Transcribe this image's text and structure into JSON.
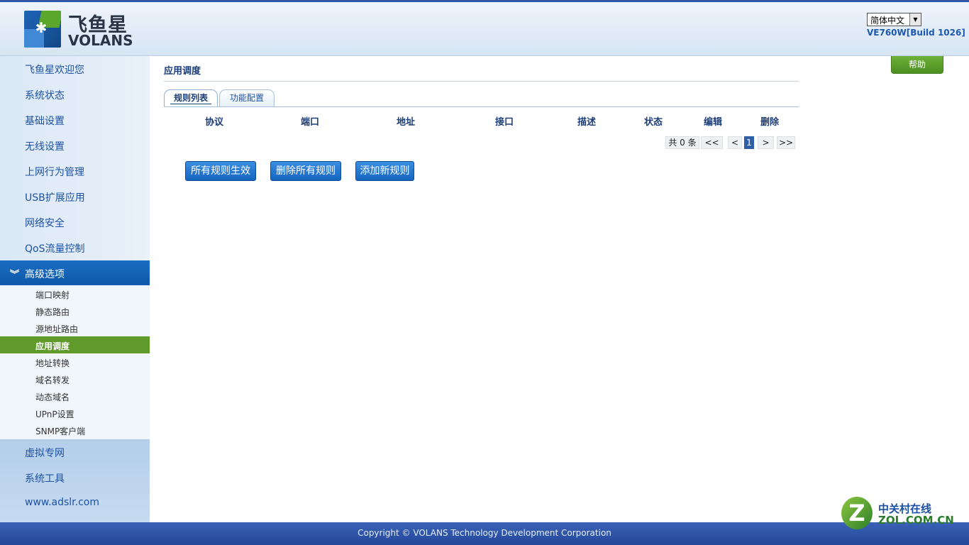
{
  "header": {
    "brand_cn": "飞鱼星",
    "brand_en": "VOLANS",
    "language_selected": "简体中文",
    "version": "VE760W[Build 1026]"
  },
  "sidebar": {
    "items": [
      {
        "label": "飞鱼星欢迎您"
      },
      {
        "label": "系统状态"
      },
      {
        "label": "基础设置"
      },
      {
        "label": "无线设置"
      },
      {
        "label": "上网行为管理"
      },
      {
        "label": "USB扩展应用"
      },
      {
        "label": "网络安全"
      },
      {
        "label": "QoS流量控制"
      },
      {
        "label": "高级选项"
      }
    ],
    "subitems": [
      {
        "label": "端口映射"
      },
      {
        "label": "静态路由"
      },
      {
        "label": "源地址路由"
      },
      {
        "label": "应用调度"
      },
      {
        "label": "地址转换"
      },
      {
        "label": "域名转发"
      },
      {
        "label": "动态域名"
      },
      {
        "label": "UPnP设置"
      },
      {
        "label": "SNMP客户端"
      }
    ],
    "lower_items": [
      {
        "label": "虚拟专网"
      },
      {
        "label": "系统工具"
      },
      {
        "label": "www.adslr.com"
      }
    ]
  },
  "main": {
    "title": "应用调度",
    "tabs": [
      {
        "label": "规则列表"
      },
      {
        "label": "功能配置"
      }
    ],
    "columns": [
      "协议",
      "端口",
      "地址",
      "接口",
      "描述",
      "状态",
      "编辑",
      "删除"
    ],
    "pagination": {
      "total": "共 0 条",
      "first": "<<",
      "prev": "<",
      "current": "1",
      "next": ">",
      "last": ">>"
    },
    "buttons": {
      "apply_all": "所有规则生效",
      "delete_all": "删除所有规则",
      "add_rule": "添加新规则"
    }
  },
  "help_label": "帮助",
  "footer": {
    "copyright": "Copyright © VOLANS Technology Development Corporation"
  },
  "watermark": {
    "cn": "中关村在线",
    "en": "ZOL.COM.CN"
  }
}
